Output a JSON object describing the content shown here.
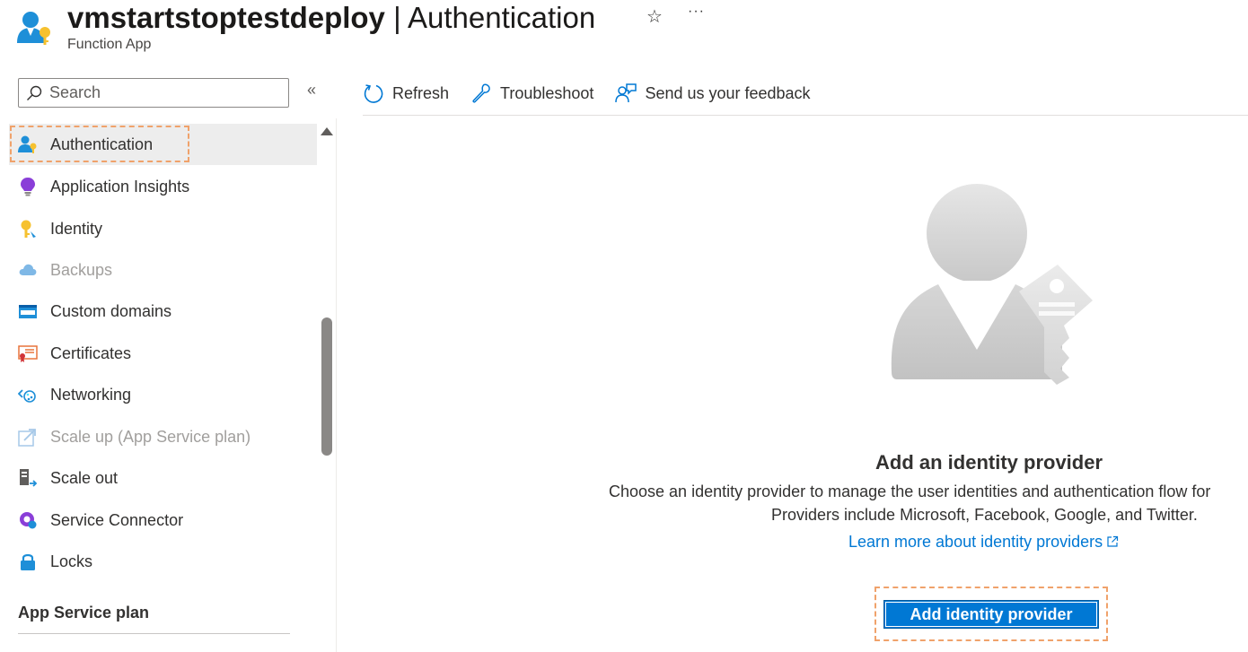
{
  "header": {
    "resource_name": "vmstartstoptestdeploy",
    "separator": " | ",
    "page_name": "Authentication",
    "subtitle": "Function App",
    "favorite_icon": "star-icon",
    "more_icon": "ellipsis-icon",
    "more_label": "···"
  },
  "sidebar": {
    "search_placeholder": "Search",
    "collapse_label": "«",
    "items": [
      {
        "label": "Authentication",
        "icon": "authentication-icon",
        "selected": true
      },
      {
        "label": "Application Insights",
        "icon": "application-insights-icon"
      },
      {
        "label": "Identity",
        "icon": "identity-icon"
      },
      {
        "label": "Backups",
        "icon": "backups-icon",
        "disabled": true
      },
      {
        "label": "Custom domains",
        "icon": "custom-domains-icon"
      },
      {
        "label": "Certificates",
        "icon": "certificates-icon"
      },
      {
        "label": "Networking",
        "icon": "networking-icon"
      },
      {
        "label": "Scale up (App Service plan)",
        "icon": "scale-up-icon",
        "disabled": true
      },
      {
        "label": "Scale out",
        "icon": "scale-out-icon"
      },
      {
        "label": "Service Connector",
        "icon": "service-connector-icon"
      },
      {
        "label": "Locks",
        "icon": "locks-icon"
      }
    ],
    "section_header": "App Service plan"
  },
  "toolbar": {
    "refresh_label": "Refresh",
    "troubleshoot_label": "Troubleshoot",
    "feedback_label": "Send us your feedback"
  },
  "empty_state": {
    "illustration_icon": "user-key-illustration",
    "title": "Add an identity provider",
    "description_line1": "Choose an identity provider to manage the user identities and authentication flow for",
    "description_line2": "Providers include Microsoft, Facebook, Google, and Twitter.",
    "learn_more_label": "Learn more about identity providers",
    "button_label": "Add identity provider"
  },
  "colors": {
    "accent": "#0078d4",
    "highlight_dash": "#f0a26b",
    "selected_bg": "#ededed"
  }
}
